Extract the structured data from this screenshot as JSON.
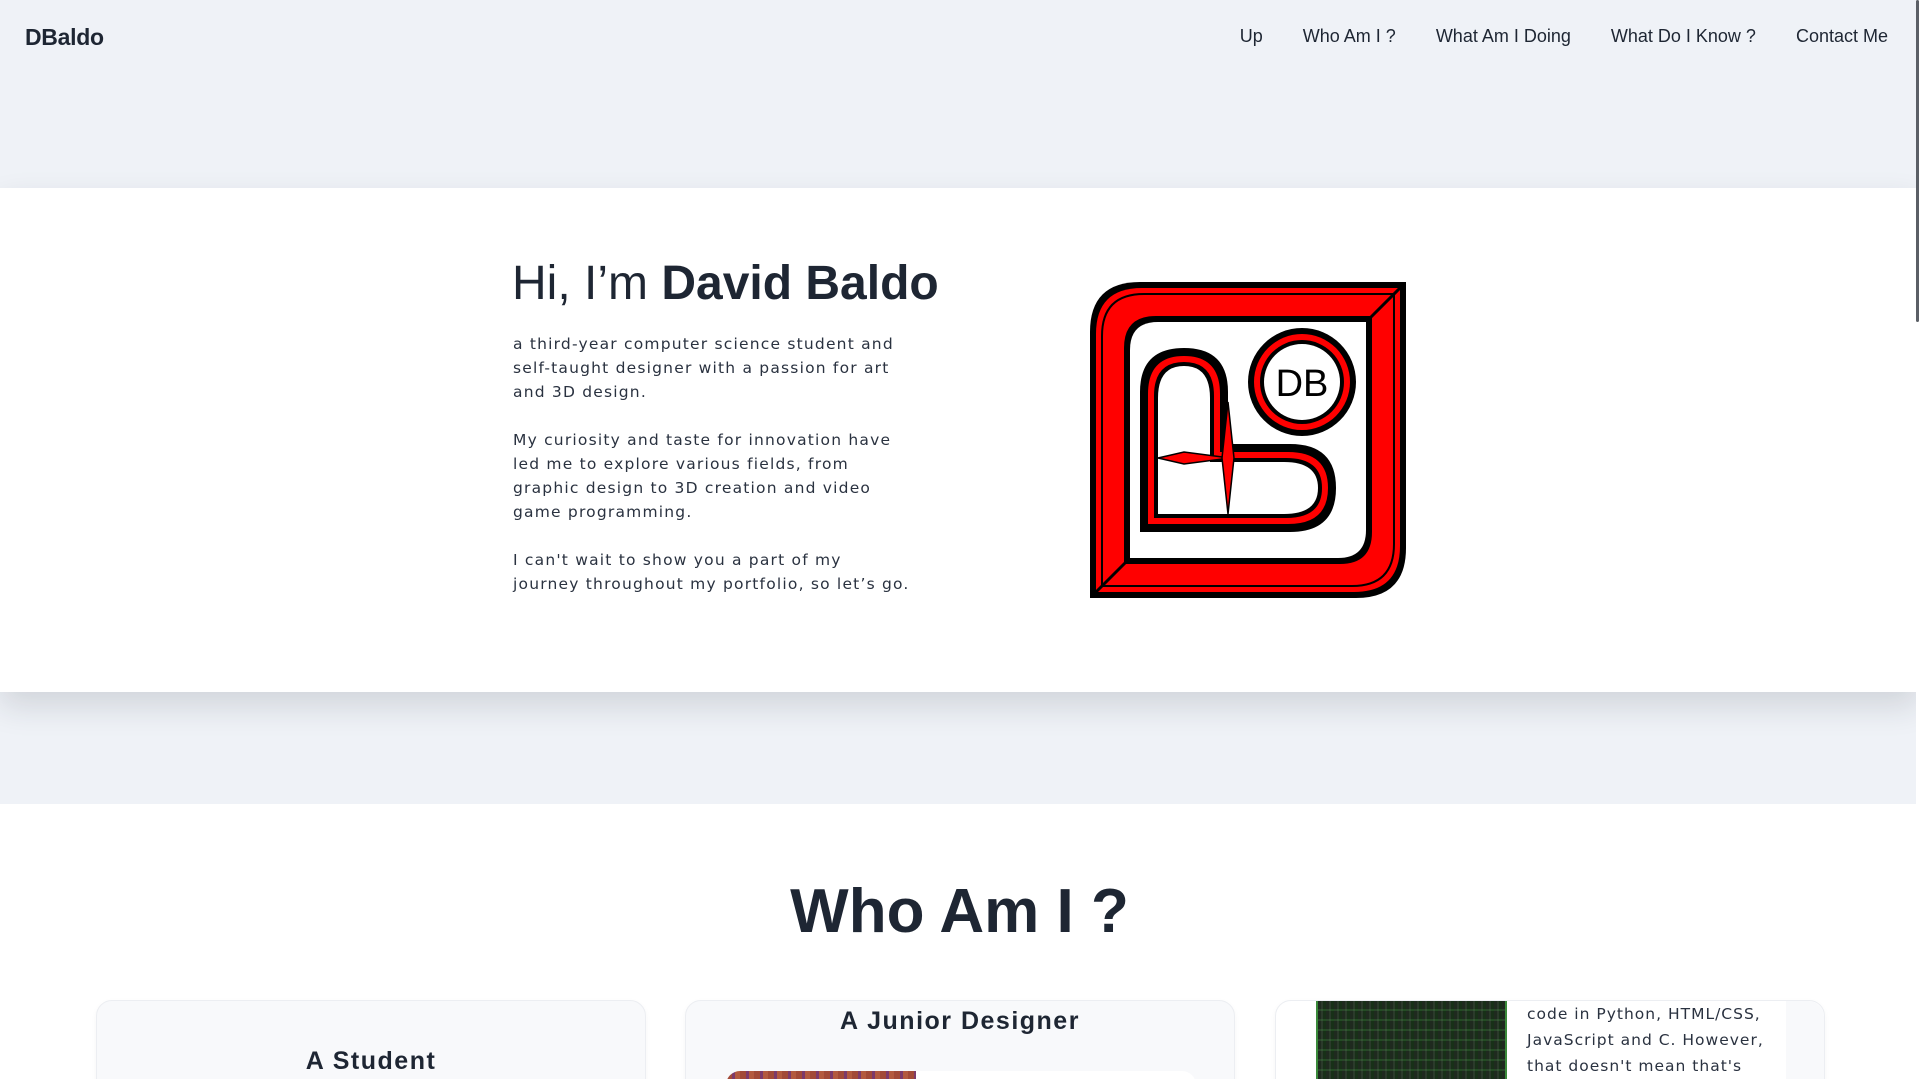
{
  "nav": {
    "brand": "DBaldo",
    "links": [
      "Up",
      "Who Am I ?",
      "What Am I Doing",
      "What Do I Know ?",
      "Contact Me"
    ]
  },
  "hero": {
    "greeting": "Hi, I’m ",
    "name": "David Baldo",
    "paragraphs": [
      "a third-year computer science student and self-taught designer with a passion for art and 3D design.",
      "My curiosity and taste for innovation have led me to explore various fields, from graphic design to 3D creation and video game programming.",
      "I can't wait to show you a part of my journey throughout my portfolio, so let’s go."
    ],
    "logo_text": "DB"
  },
  "who": {
    "title": "Who Am I ?",
    "cards": [
      {
        "title": "A Student"
      },
      {
        "title": "A Junior Designer"
      },
      {
        "text": "code in Python, HTML/CSS, JavaScript and C. However, that doesn't mean that's"
      }
    ]
  },
  "colors": {
    "background": "#eff2f7",
    "text": "#1e2633",
    "logo_red": "#ff0000",
    "logo_black": "#000000"
  }
}
